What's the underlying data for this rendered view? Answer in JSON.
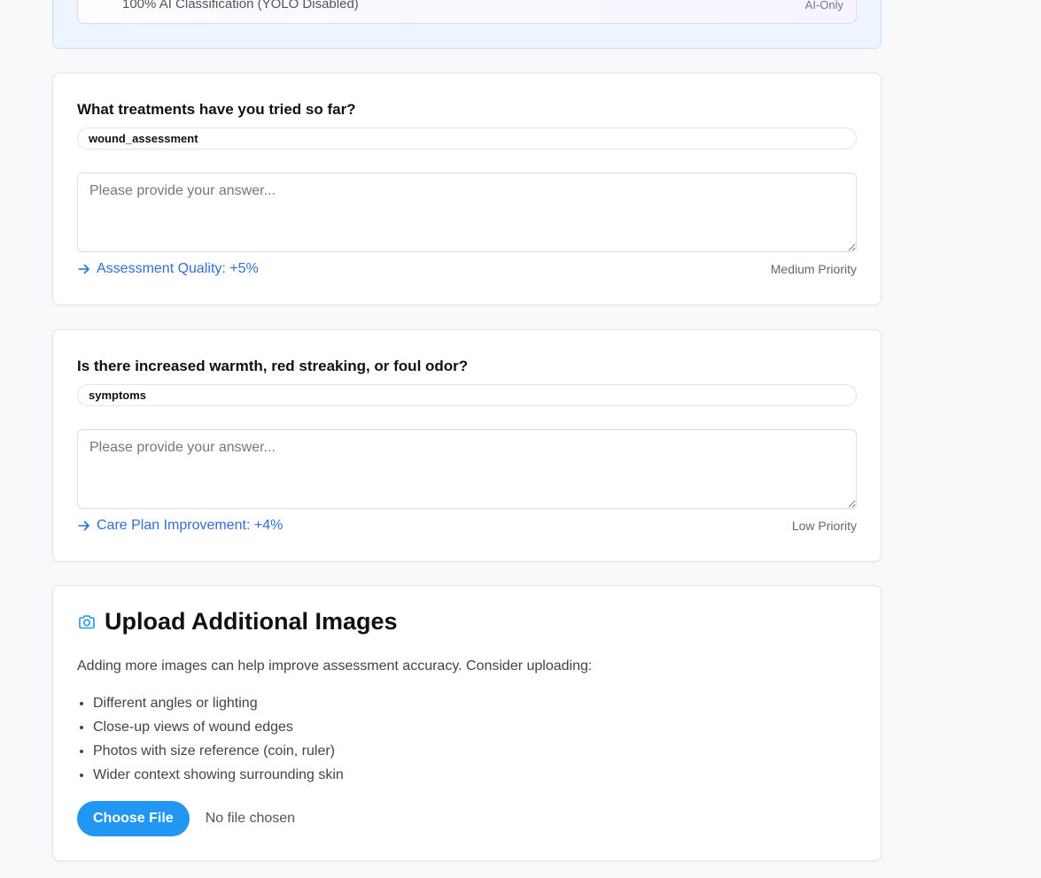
{
  "top_panel": {
    "mode_text": "100% AI Classification (YOLO Disabled)",
    "mode_tag": "AI-Only"
  },
  "questions": [
    {
      "question": "What treatments have you tried so far?",
      "category": "wound_assessment",
      "placeholder": "Please provide your answer...",
      "impact": "Assessment Quality: +5%",
      "priority": "Medium Priority"
    },
    {
      "question": "Is there increased warmth, red streaking, or foul odor?",
      "category": "symptoms",
      "placeholder": "Please provide your answer...",
      "impact": "Care Plan Improvement: +4%",
      "priority": "Low Priority"
    }
  ],
  "upload": {
    "icon": "camera-icon",
    "title": "Upload Additional Images",
    "description": "Adding more images can help improve assessment accuracy. Consider uploading:",
    "tips": [
      "Different angles or lighting",
      "Close-up views of wound edges",
      "Photos with size reference (coin, ruler)",
      "Wider context showing surrounding skin"
    ],
    "button_label": "Choose File",
    "file_status": "No file chosen"
  },
  "colors": {
    "accent_blue": "#2196f3",
    "link_blue": "#2f6fd3",
    "page_bg": "#f8f9fb"
  }
}
